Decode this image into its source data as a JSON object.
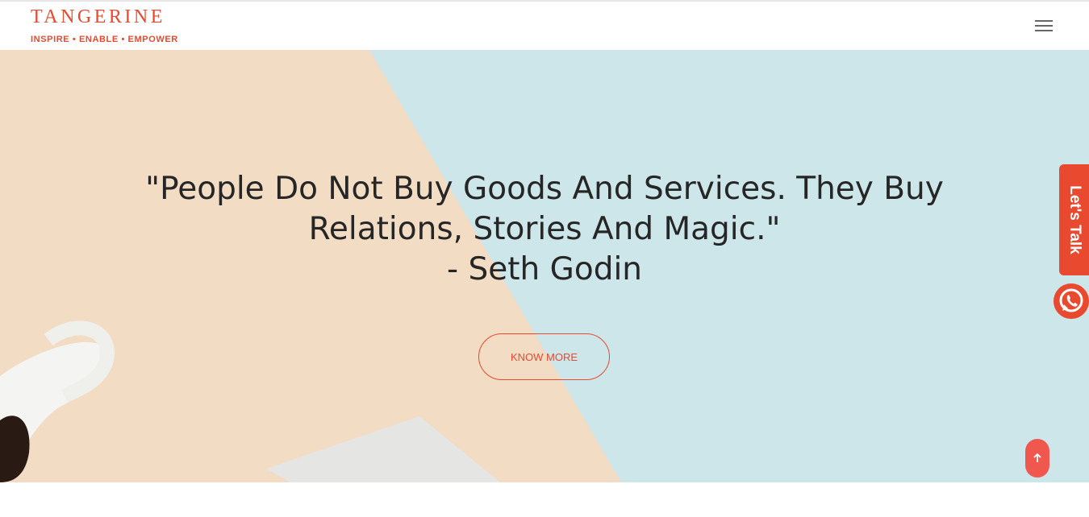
{
  "brand": {
    "name": "TANGERINE",
    "tagline": "INSPIRE • ENABLE • EMPOWER",
    "color": "#e8492f"
  },
  "nav": {
    "menu_icon": "hamburger-menu-icon"
  },
  "hero": {
    "quote_lines": [
      "\"People Do Not Buy Goods And Services. They Buy",
      "Relations, Stories And Magic.\"",
      "- Seth Godin"
    ],
    "button_label": "KNOW MORE",
    "bg_colors": {
      "peach": "#f3dcc4",
      "blue": "#cde6ea"
    }
  },
  "side": {
    "lets_talk_label": "Let's Talk",
    "whatsapp_icon": "whatsapp-icon",
    "scroll_top_icon": "arrow-up-icon"
  }
}
